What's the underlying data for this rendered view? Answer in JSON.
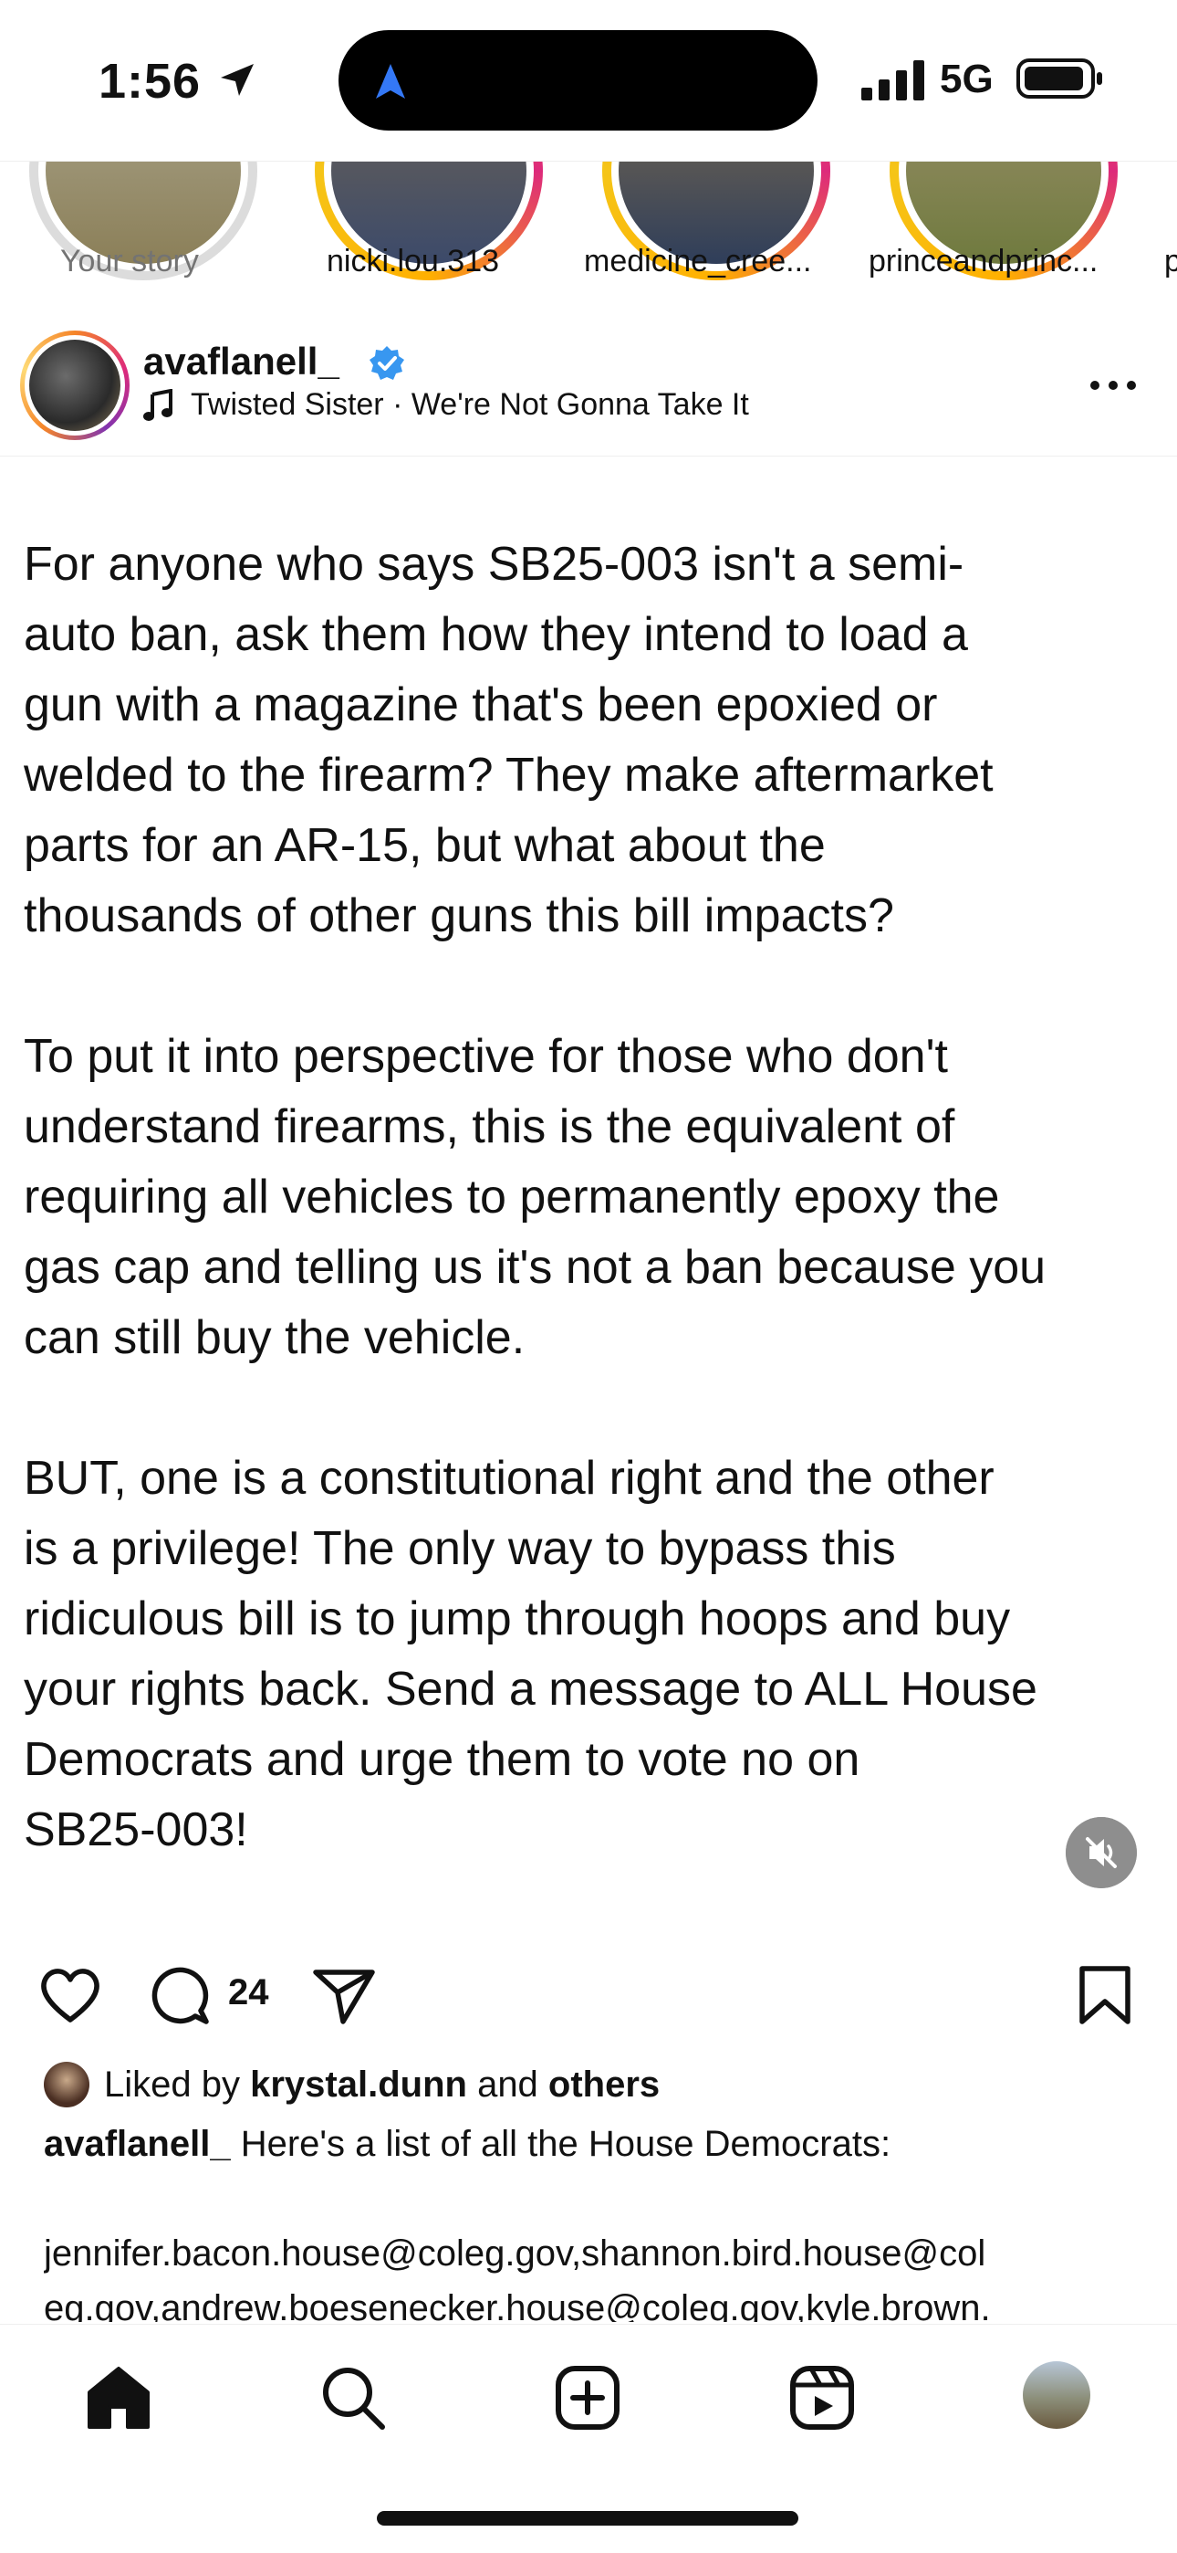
{
  "status_bar": {
    "time": "1:56",
    "network": "5G"
  },
  "stories": [
    {
      "label": "Your story",
      "ring": "none",
      "add_badge": "+"
    },
    {
      "label": "nicki.lou.313",
      "ring": "gradient"
    },
    {
      "label": "medicine_cree...",
      "ring": "gradient"
    },
    {
      "label": "princeandprinc...",
      "ring": "gradient"
    },
    {
      "label": "p",
      "ring": "gradient"
    }
  ],
  "post": {
    "username": "avaflanell_",
    "verified": true,
    "music": "Twisted Sister · We're Not Gonna Take It",
    "text": "For anyone who says SB25-003 isn't a semi-\nauto ban, ask them how they intend to load a\ngun with a magazine that's been epoxied or\nwelded to the firearm? They make aftermarket\nparts for an AR-15, but what about the\nthousands of other guns this bill impacts?\n\nTo put it into perspective for those who don't\nunderstand firearms, this is the equivalent of\nrequiring all vehicles to permanently epoxy the\ngas cap and telling us it's not a ban because you\ncan still buy the vehicle.\n\nBUT, one is a constitutional right and the other\nis a privilege! The only way to bypass this\nridiculous bill is to jump through hoops and buy\nyour rights back. Send a message to ALL House\nDemocrats and urge them to vote no on\nSB25-003!",
    "comment_count": "24"
  },
  "likes": {
    "prefix": "Liked by ",
    "user": "krystal.dunn",
    "middle": " and ",
    "others": "others"
  },
  "caption": {
    "username": "avaflanell_",
    "text": " Here's a list of all the House Democrats:\n\njennifer.bacon.house@coleg.gov,shannon.bird.house@col\neg.gov,andrew.boesenecker.house@coleg.gov,kyle.brown.\nhouse@coleg.gov,sean.camacho.house@coleg.gov,michae"
  },
  "colors": {
    "verified_blue": "#3897f0",
    "accent_blue": "#3478f6",
    "text": "#111111",
    "muted": "#737373"
  },
  "icons": {
    "nav": [
      "home-icon",
      "search-icon",
      "create-icon",
      "reels-icon",
      "profile-avatar"
    ],
    "actions": [
      "heart-icon",
      "comment-icon",
      "share-icon",
      "bookmark-icon"
    ]
  }
}
